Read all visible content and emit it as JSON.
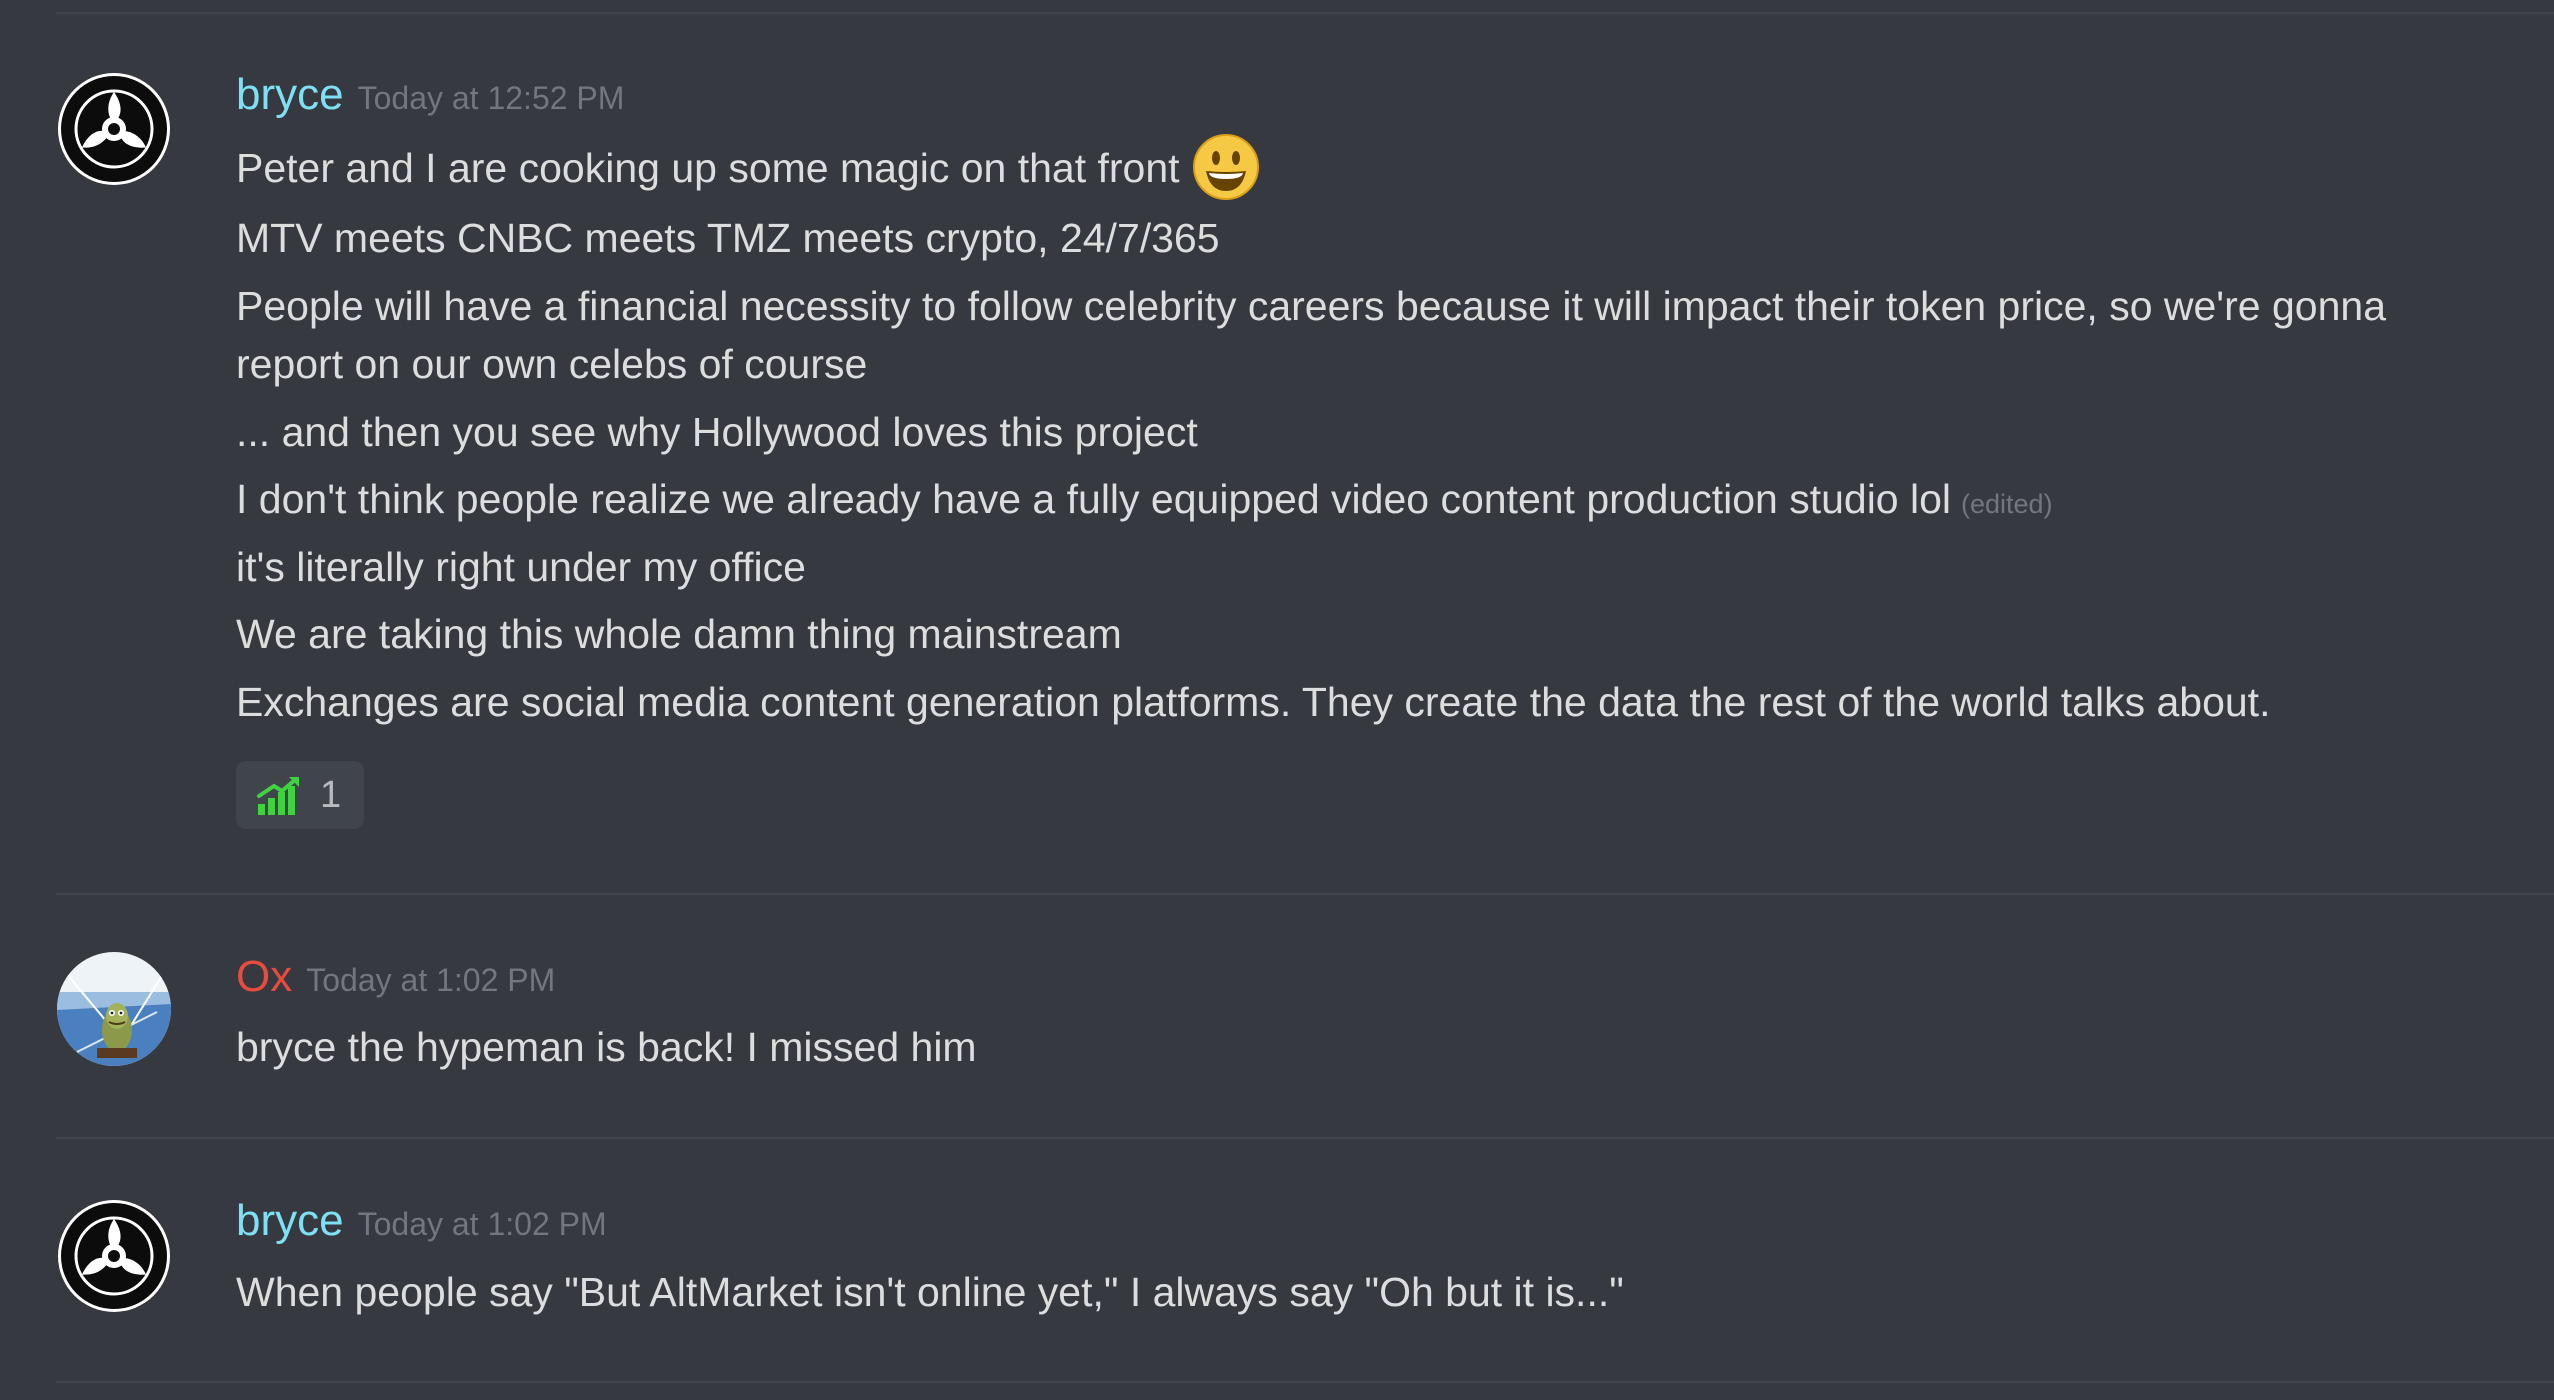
{
  "colors": {
    "background": "#36393f",
    "bryce_name": "#7ee0f5",
    "ox_name": "#e74c3c",
    "text": "#dcddde",
    "muted": "#72767d",
    "reaction_bg": "#40444b",
    "chart_green": "#3fd43f"
  },
  "messages": [
    {
      "author": "bryce",
      "timestamp": "Today at 12:52 PM",
      "avatar_icon": "record-45-adapter-icon",
      "lines": [
        "Peter and I are cooking up some magic on that front",
        "MTV meets CNBC meets TMZ meets crypto, 24/7/365",
        "People will have a financial necessity to follow celebrity careers because it will impact their token price, so we're gonna report on our own celebs of course",
        "... and then you see why Hollywood loves this project",
        "I don't think people realize we already have a fully equipped video content production studio lol",
        "it's literally right under my office",
        "We are taking this whole damn thing mainstream",
        "Exchanges are social media content generation platforms.  They create the data the rest of the world talks about."
      ],
      "edited_label": "(edited)",
      "emoji_icon": "smiley-face-icon",
      "reaction": {
        "icon": "chart-increasing-icon",
        "count": "1"
      }
    },
    {
      "author": "Ox",
      "timestamp": "Today at 1:02 PM",
      "avatar_icon": "cartoon-character-avatar-icon",
      "lines": [
        "bryce the hypeman is back! I missed him"
      ]
    },
    {
      "author": "bryce",
      "timestamp": "Today at 1:02 PM",
      "avatar_icon": "record-45-adapter-icon",
      "lines": [
        "When people say \"But AltMarket isn't online yet,\" I always say \"Oh but it is...\""
      ]
    }
  ]
}
